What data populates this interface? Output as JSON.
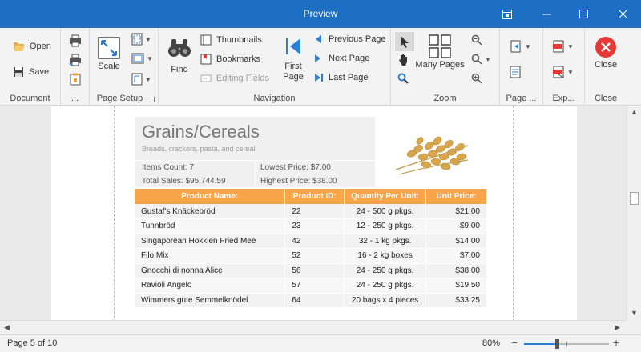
{
  "window": {
    "title": "Preview"
  },
  "ribbon": {
    "document": {
      "label": "Document",
      "open": "Open",
      "save": "Save"
    },
    "print": {
      "label": "..."
    },
    "page_setup": {
      "label": "Page Setup",
      "scale": "Scale"
    },
    "navigation": {
      "label": "Navigation",
      "find": "Find",
      "thumbnails": "Thumbnails",
      "bookmarks": "Bookmarks",
      "editing_fields": "Editing Fields",
      "first_page_1": "First",
      "first_page_2": "Page",
      "previous_page": "Previous Page",
      "next_page": "Next Page",
      "last_page": "Last Page"
    },
    "zoom": {
      "label": "Zoom",
      "many_pages": "Many Pages"
    },
    "page_background": {
      "label": "Page ..."
    },
    "export": {
      "label": "Exp..."
    },
    "close": {
      "label": "Close",
      "button": "Close"
    }
  },
  "report": {
    "category": "Grains/Cereals",
    "description": "Breads, crackers, pasta, and cereal",
    "items_count": "Items Count: 7",
    "lowest_price": "Lowest Price: $7.00",
    "total_sales": "Total Sales: $95,744.59",
    "highest_price": "Highest Price: $38.00",
    "columns": [
      "Product Name:",
      "Product ID:",
      "Quantity Per Unit:",
      "Unit Price:"
    ],
    "rows": [
      [
        "Gustaf's Knäckebröd",
        "22",
        "24 - 500 g pkgs.",
        "$21.00"
      ],
      [
        "Tunnbröd",
        "23",
        "12 - 250 g pkgs.",
        "$9.00"
      ],
      [
        "Singaporean Hokkien Fried Mee",
        "42",
        "32 - 1 kg pkgs.",
        "$14.00"
      ],
      [
        "Filo Mix",
        "52",
        "16 - 2 kg boxes",
        "$7.00"
      ],
      [
        "Gnocchi di nonna Alice",
        "56",
        "24 - 250 g pkgs.",
        "$38.00"
      ],
      [
        "Ravioli Angelo",
        "57",
        "24 - 250 g pkgs.",
        "$19.50"
      ],
      [
        "Wimmers gute Semmelknödel",
        "64",
        "20 bags x 4 pieces",
        "$33.25"
      ]
    ]
  },
  "status": {
    "page": "Page 5 of 10",
    "zoom": "80%"
  },
  "colors": {
    "titlebar": "#1d6fc4",
    "header": "#f7a44a",
    "close": "#e53935",
    "accent": "#2a7fd4"
  }
}
